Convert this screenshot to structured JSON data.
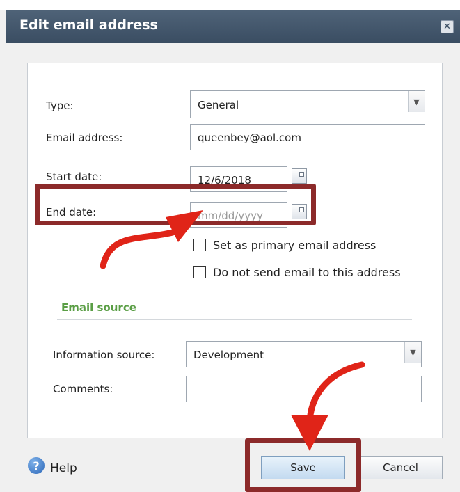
{
  "dialog": {
    "title": "Edit email address",
    "close_icon": "close-icon"
  },
  "form": {
    "type_label": "Type:",
    "type_value": "General",
    "email_label": "Email address:",
    "email_value": "queenbey@aol.com",
    "start_label": "Start date:",
    "start_value": "12/6/2018",
    "end_label": "End date:",
    "end_placeholder": "mm/dd/yyyy",
    "primary_label": "Set as primary email address",
    "primary_checked": false,
    "nosend_label": "Do not send email to this address",
    "nosend_checked": false
  },
  "email_source": {
    "title": "Email source",
    "info_label": "Information source:",
    "info_value": "Development",
    "comments_label": "Comments:",
    "comments_value": ""
  },
  "footer": {
    "help_label": "Help",
    "save_label": "Save",
    "cancel_label": "Cancel"
  },
  "annotations": {
    "highlight_color": "#8c2a2a",
    "arrow_color": "#e02418"
  }
}
